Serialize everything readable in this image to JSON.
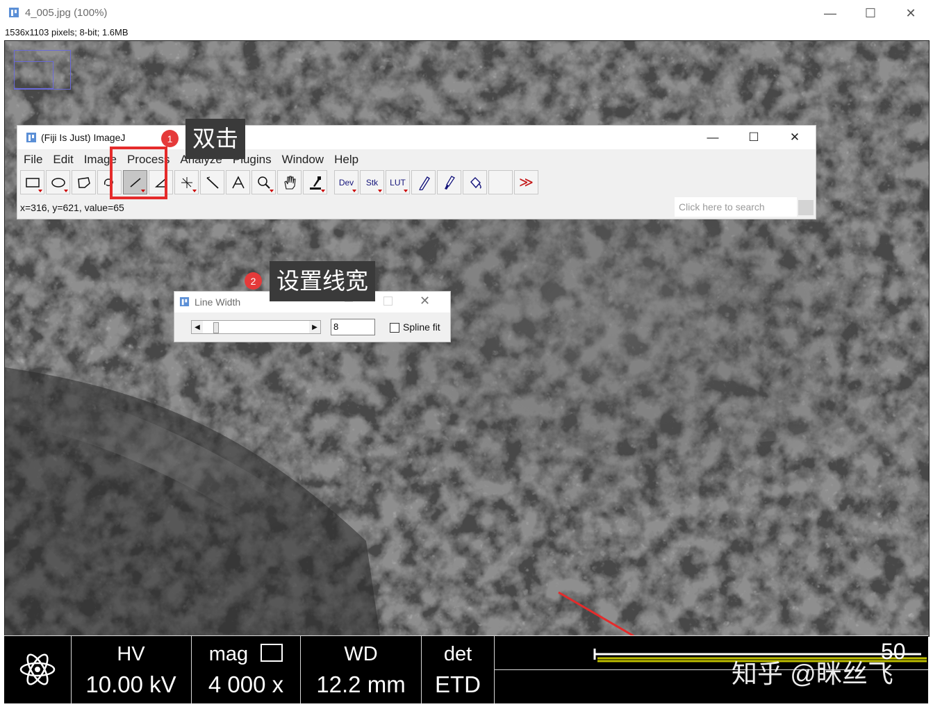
{
  "outer_window": {
    "title": "4_005.jpg (100%)",
    "image_info": "1536x1103 pixels; 8-bit; 1.6MB"
  },
  "fiji": {
    "title": "(Fiji Is Just) ImageJ",
    "menu": [
      "File",
      "Edit",
      "Image",
      "Process",
      "Analyze",
      "Plugins",
      "Window",
      "Help"
    ],
    "tools": {
      "dev": "Dev",
      "stk": "Stk",
      "lut": "LUT",
      "more": "≫"
    },
    "status": "x=316, y=621, value=65",
    "search_placeholder": "Click here to search"
  },
  "line_width_dialog": {
    "title": "Line Width",
    "value": "8",
    "spline_label": "Spline fit"
  },
  "annotations": {
    "step1_badge": "1",
    "step1_text": "双击",
    "step2_badge": "2",
    "step2_text": "设置线宽"
  },
  "databar": {
    "hv_label": "HV",
    "hv_value": "10.00 kV",
    "mag_label": "mag",
    "mag_value": "4 000 x",
    "wd_label": "WD",
    "wd_value": "12.2 mm",
    "det_label": "det",
    "det_value": "ETD",
    "scale_label": "50",
    "watermark": "知乎 @眯丝飞"
  },
  "colors": {
    "annotation_red": "#e52b2b",
    "tip_background": "#3a3a3a",
    "scale_line_yellow": "#d4d400"
  }
}
